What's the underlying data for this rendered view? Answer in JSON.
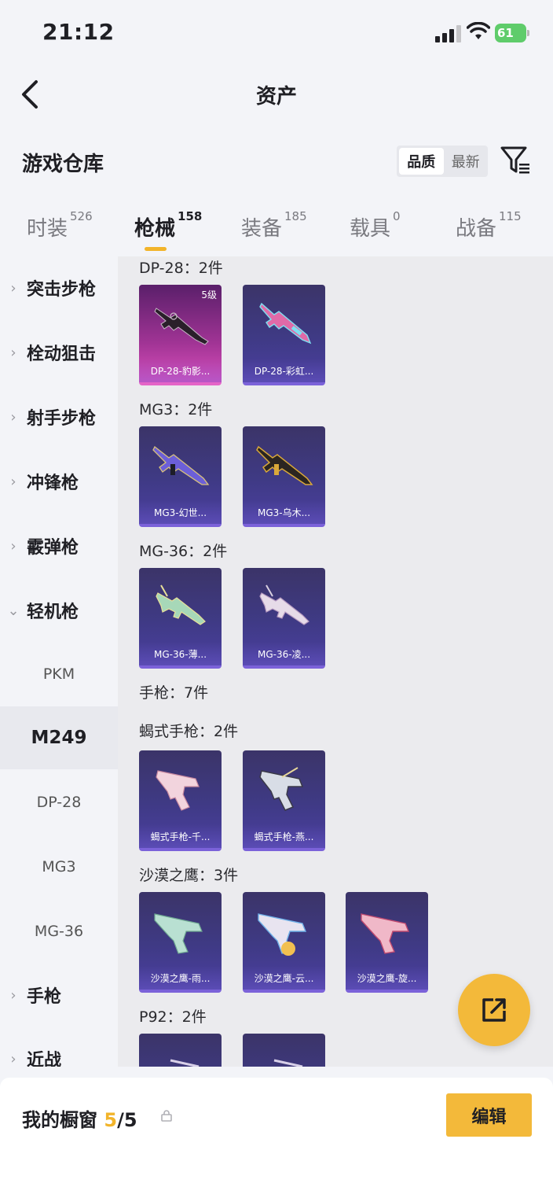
{
  "status_bar": {
    "time": "21:12",
    "battery": "61"
  },
  "header": {
    "title": "资产"
  },
  "section": {
    "title": "游戏仓库",
    "sort_options": [
      "品质",
      "最新"
    ]
  },
  "tabs": [
    {
      "label": "时装",
      "count": "526"
    },
    {
      "label": "枪械",
      "count": "158"
    },
    {
      "label": "装备",
      "count": "185"
    },
    {
      "label": "载具",
      "count": "0"
    },
    {
      "label": "战备",
      "count": "115"
    }
  ],
  "sidebar": {
    "categories": [
      {
        "label": "突击步枪",
        "chev": "›"
      },
      {
        "label": "栓动狙击",
        "chev": "›"
      },
      {
        "label": "射手步枪",
        "chev": "›"
      },
      {
        "label": "冲锋枪",
        "chev": "›"
      },
      {
        "label": "霰弹枪",
        "chev": "›"
      },
      {
        "label": "轻机枪",
        "chev": "⌄"
      },
      {
        "label": "手枪",
        "chev": "›"
      },
      {
        "label": "近战",
        "chev": "›"
      }
    ],
    "subitems": [
      "PKM",
      "M249",
      "DP-28",
      "MG3",
      "MG-36"
    ]
  },
  "groups": [
    {
      "title": "DP-28：2件",
      "items": [
        {
          "name": "DP-28-豹影...",
          "badge": "5级",
          "rarity": "pink"
        },
        {
          "name": "DP-28-彩虹..."
        }
      ]
    },
    {
      "title": "MG3：2件",
      "items": [
        {
          "name": "MG3-幻世..."
        },
        {
          "name": "MG3-乌木..."
        }
      ]
    },
    {
      "title": "MG-36：2件",
      "items": [
        {
          "name": "MG-36-薄..."
        },
        {
          "name": "MG-36-凌..."
        }
      ]
    },
    {
      "title": "手枪：7件"
    },
    {
      "title": "蝎式手枪：2件",
      "items": [
        {
          "name": "蝎式手枪-千..."
        },
        {
          "name": "蝎式手枪-燕..."
        }
      ]
    },
    {
      "title": "沙漠之鹰：3件",
      "items": [
        {
          "name": "沙漠之鹰-雨..."
        },
        {
          "name": "沙漠之鹰-云..."
        },
        {
          "name": "沙漠之鹰-旋..."
        }
      ]
    },
    {
      "title": "P92：2件"
    }
  ],
  "bottom_bar": {
    "label": "我的橱窗",
    "current": "5",
    "separator": "/",
    "total": "5",
    "edit_label": "编辑"
  },
  "colors": {
    "accent": "#f3b93a",
    "card_purple": "#3f3a85",
    "card_pink": "#d94fbb"
  }
}
